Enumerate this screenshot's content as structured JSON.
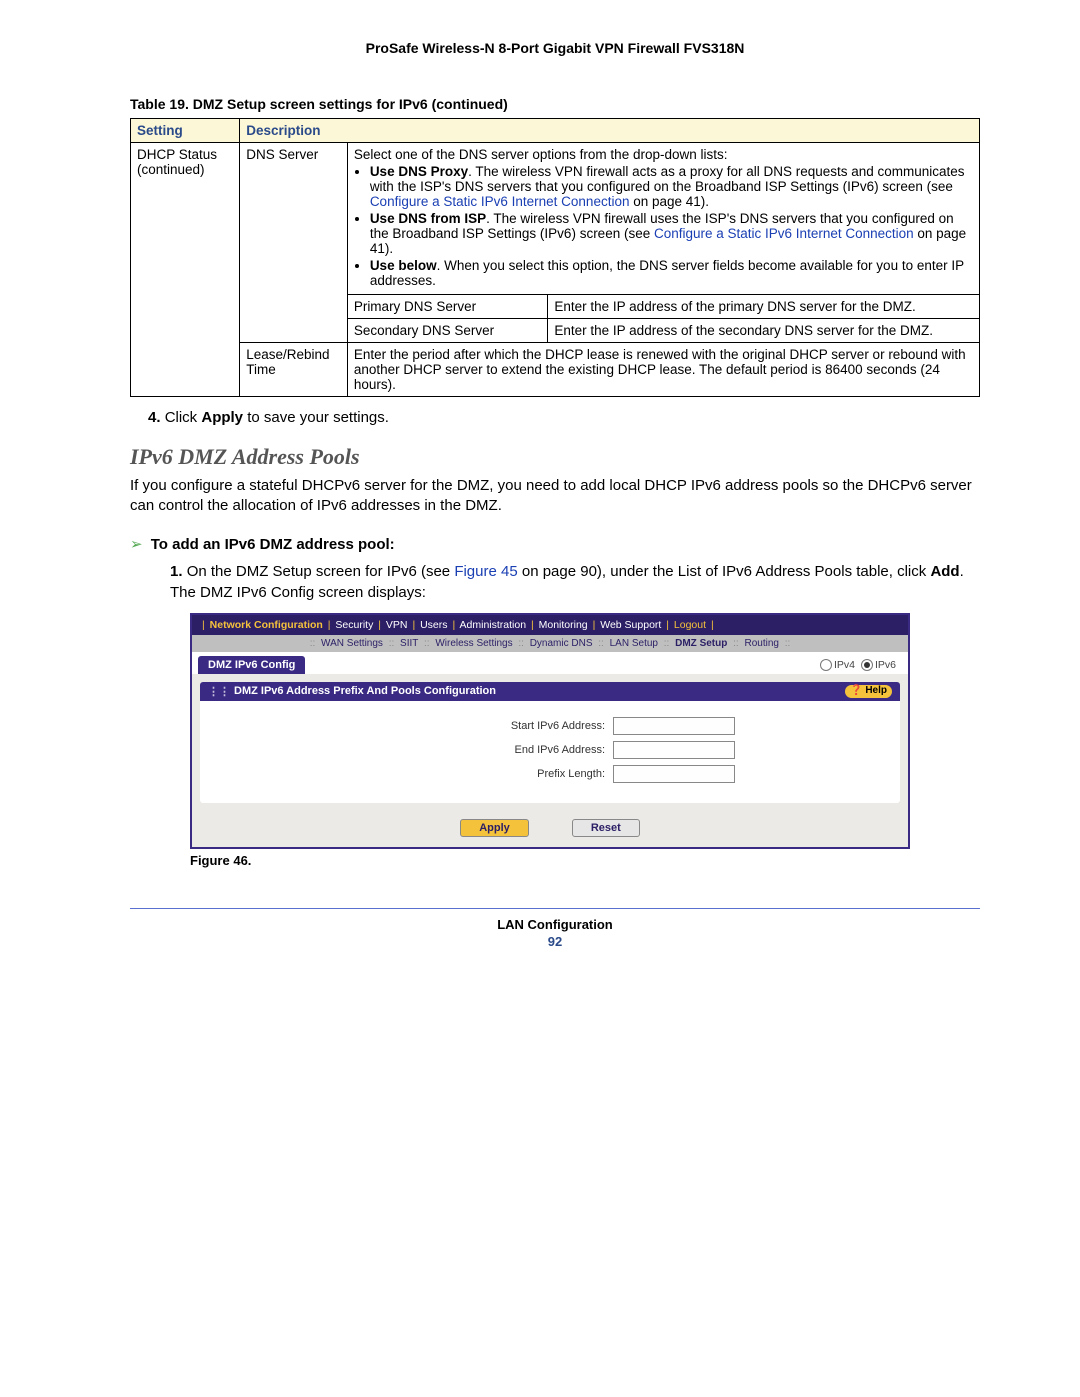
{
  "doc_title": "ProSafe Wireless-N 8-Port Gigabit VPN Firewall FVS318N",
  "table_caption": "Table 19.  DMZ Setup screen settings for IPv6 (continued)",
  "table_headers": {
    "setting": "Setting",
    "description": "Description"
  },
  "table_rows": {
    "dhcp_status": "DHCP Status (continued)",
    "dns_server": "DNS Server",
    "dns_server_intro": "Select one of the DNS server options from the drop-down lists:",
    "opt1_label": "Use DNS Proxy",
    "opt1_text": ". The wireless VPN firewall acts as a proxy for all DNS requests and communicates with the ISP's DNS servers that you configured on the Broadband ISP Settings (IPv6) screen (see ",
    "opt1_link": "Configure a Static IPv6 Internet Connection",
    "opt1_tail": " on page 41).",
    "opt2_label": "Use DNS from ISP",
    "opt2_text": ". The wireless VPN firewall uses the ISP's DNS servers that you configured on the Broadband ISP Settings (IPv6) screen (see ",
    "opt2_link": "Configure a Static IPv6 Internet Connection",
    "opt2_tail": " on page 41).",
    "opt3_label": "Use below",
    "opt3_text": ". When you select this option, the DNS server fields become available for you to enter IP addresses.",
    "primary_dns_label": "Primary DNS Server",
    "primary_dns_desc": "Enter the IP address of the primary DNS server for the DMZ.",
    "secondary_dns_label": "Secondary DNS Server",
    "secondary_dns_desc": "Enter the IP address of the secondary DNS server for the DMZ.",
    "lease_label": "Lease/Rebind Time",
    "lease_desc": "Enter the period after which the DHCP lease is renewed with the original DHCP server or rebound with another DHCP server to extend the existing DHCP lease. The default period is 86400 seconds (24 hours)."
  },
  "step4": {
    "num": "4.",
    "pre": "Click ",
    "bold": "Apply",
    "post": " to save your settings."
  },
  "section_heading": "IPv6 DMZ Address Pools",
  "section_body": "If you configure a stateful DHCPv6 server for the DMZ, you need to add local DHCP IPv6 address pools so the DHCPv6 server can control the allocation of IPv6 addresses in the DMZ.",
  "proc_heading": "To add an IPv6 DMZ address pool:",
  "substep1": {
    "num": "1.",
    "pre": "On the DMZ Setup screen for IPv6 (see ",
    "figref": "Figure 45",
    "mid": " on page 90), under the List of IPv6 Address Pools table, click ",
    "bold": "Add",
    "post": ". The DMZ IPv6 Config screen displays:"
  },
  "figure": {
    "topnav_items": [
      "Network Configuration",
      "Security",
      "VPN",
      "Users",
      "Administration",
      "Monitoring",
      "Web Support",
      "Logout"
    ],
    "topnav_active": 0,
    "subnav_items": [
      "WAN Settings",
      "SIIT",
      "Wireless Settings",
      "Dynamic DNS",
      "LAN Setup",
      "DMZ Setup",
      "Routing"
    ],
    "subnav_active": 5,
    "tab_label": "DMZ IPv6 Config",
    "ipv4_label": "IPv4",
    "ipv6_label": "IPv6",
    "panel_title": "DMZ IPv6 Address Prefix And Pools Configuration",
    "help_label": "Help",
    "fields": {
      "start": "Start IPv6 Address:",
      "end": "End IPv6 Address:",
      "prefix": "Prefix Length:"
    },
    "apply_btn": "Apply",
    "reset_btn": "Reset"
  },
  "figure_caption": "Figure 46.",
  "footer": {
    "section": "LAN Configuration",
    "pagenum": "92"
  }
}
